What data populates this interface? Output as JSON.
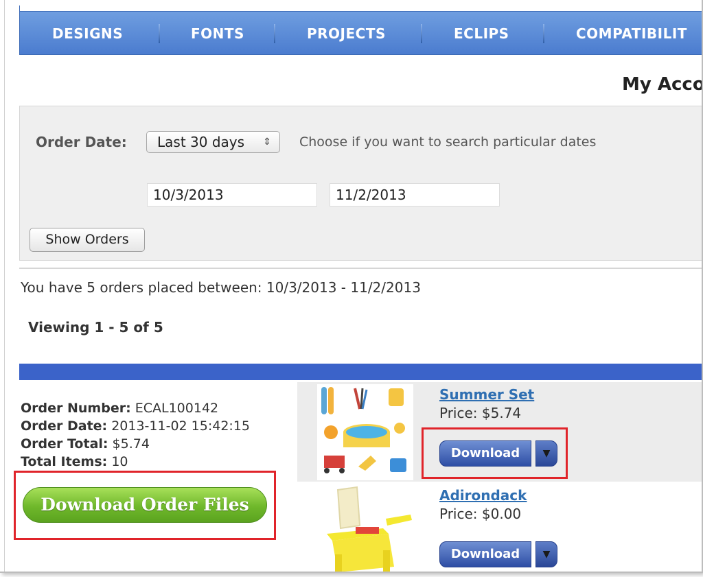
{
  "nav": {
    "items": [
      "DESIGNS",
      "FONTS",
      "PROJECTS",
      "ECLIPS",
      "COMPATIBILIT"
    ],
    "bg_color": "#4b7ccf"
  },
  "page": {
    "title": "My Acco"
  },
  "filter": {
    "label": "Order Date:",
    "range_selected": "Last 30 days",
    "hint": "Choose if you want to search particular dates",
    "start_date": "10/3/2013",
    "end_date": "11/2/2013",
    "show_button": "Show Orders"
  },
  "results": {
    "summary": "You have 5 orders placed between: 10/3/2013 - 11/2/2013",
    "viewing": "Viewing 1 - 5 of 5"
  },
  "order": {
    "number_label": "Order Number:",
    "number": "ECAL100142",
    "date_label": "Order Date:",
    "date": "2013-11-02 15:42:15",
    "total_label": "Order Total:",
    "total": "$5.74",
    "items_label": "Total Items:",
    "items": "10",
    "download_all": "Download Order Files",
    "products": [
      {
        "name": "Summer Set",
        "price": "Price: $5.74",
        "button": "Download"
      },
      {
        "name": "Adirondack",
        "price": "Price: $0.00",
        "button": "Download"
      }
    ]
  },
  "colors": {
    "accent_blue": "#3b63c9",
    "link": "#2f6fb2",
    "highlight_red": "#e0242a",
    "green_button": "#6fb82b"
  }
}
